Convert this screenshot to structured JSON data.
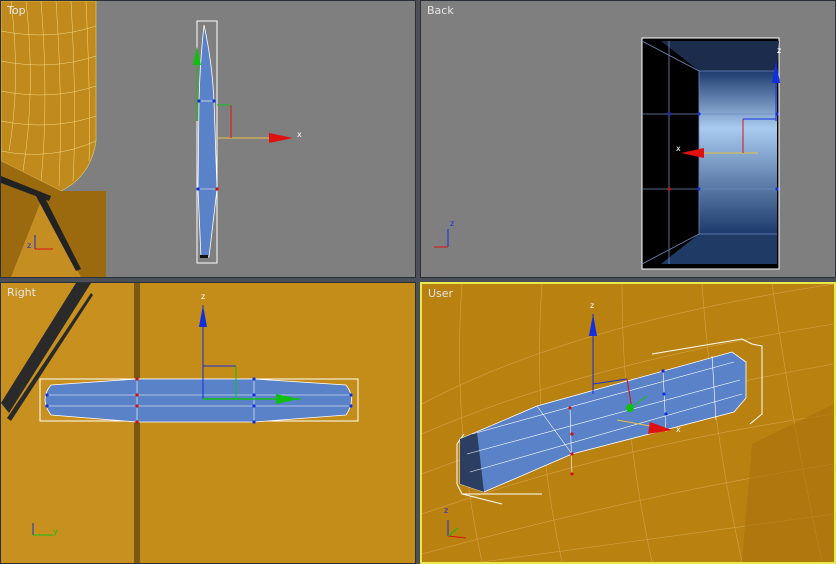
{
  "viewports": {
    "top": {
      "label": "Top"
    },
    "back": {
      "label": "Back"
    },
    "right": {
      "label": "Right"
    },
    "user": {
      "label": "User"
    }
  },
  "axis_labels": {
    "x": "x",
    "y": "y",
    "z": "z"
  },
  "colors": {
    "viewport_bg": "#7f7f7f",
    "wood": "#c28a16",
    "mesh_blue": "#5a82c8",
    "active_border": "#e8e84a",
    "axis_x": "#e01010",
    "axis_y": "#10c010",
    "axis_z": "#1030e0"
  }
}
